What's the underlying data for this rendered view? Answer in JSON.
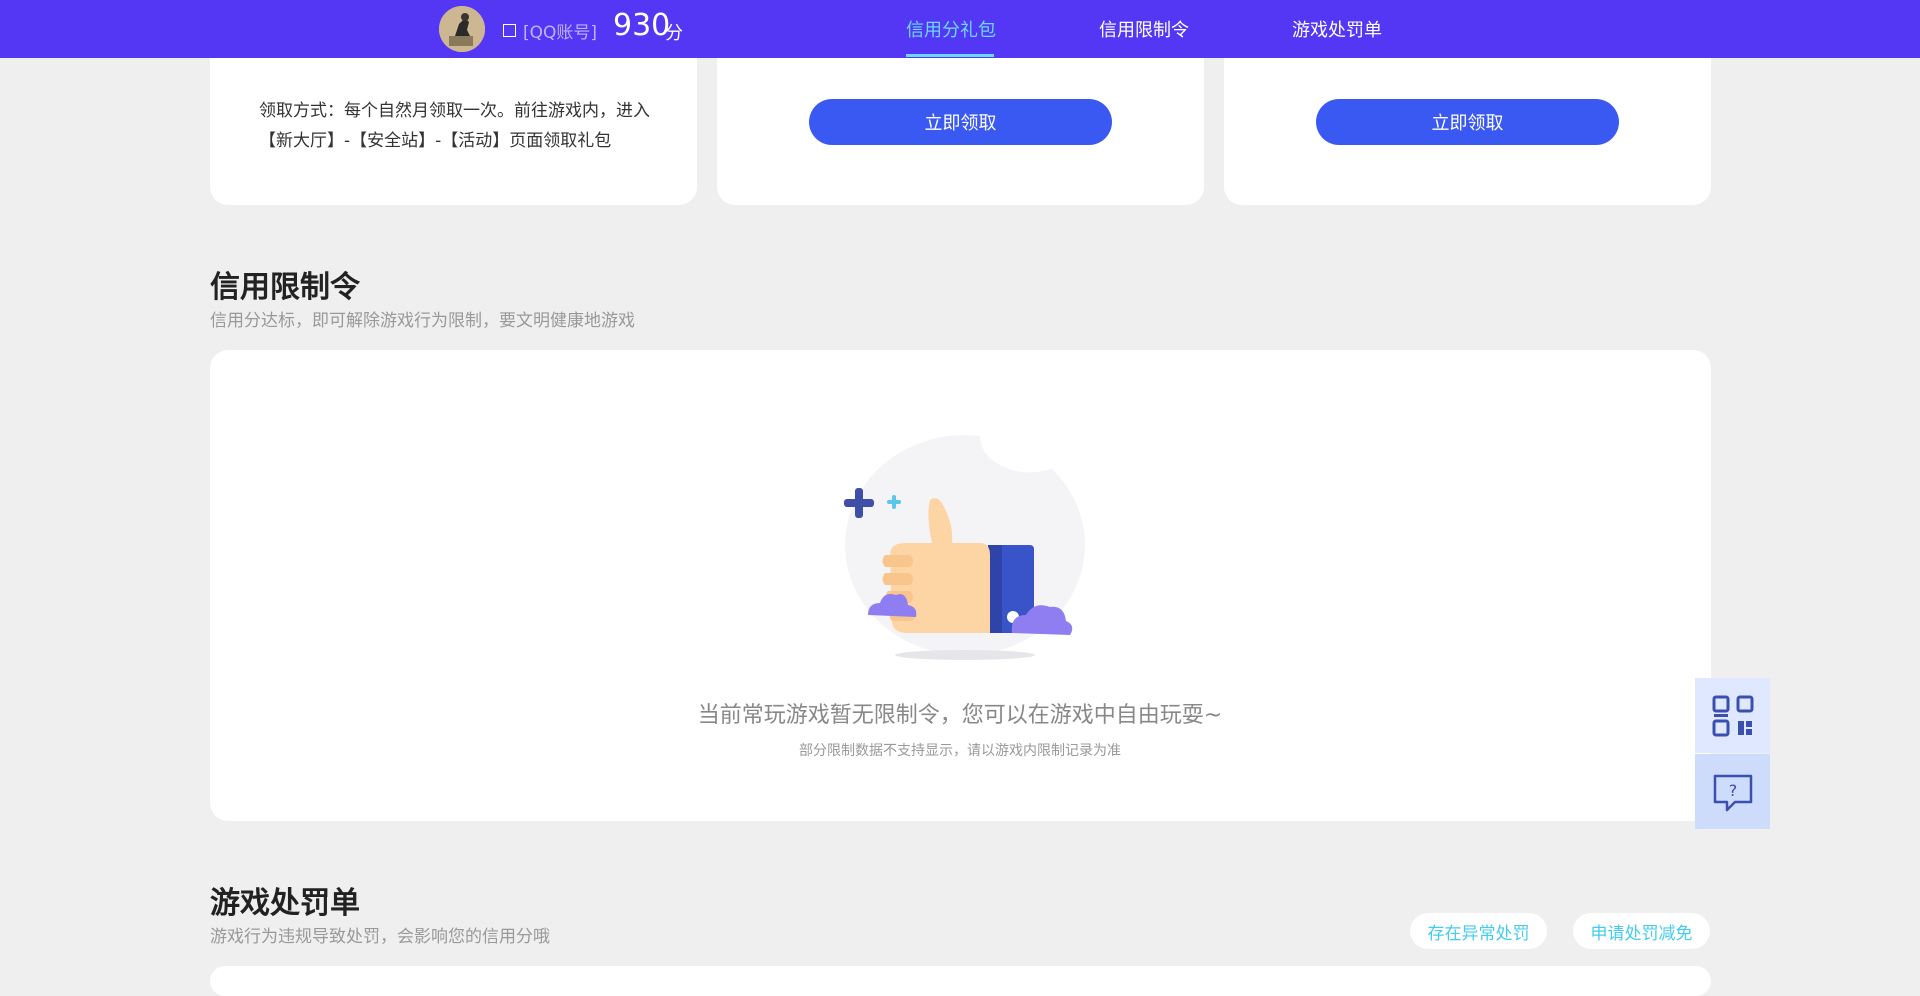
{
  "header": {
    "account_label": "[QQ账号]",
    "score": "930",
    "score_unit": "分",
    "tabs": [
      {
        "label": "信用分礼包",
        "active": true
      },
      {
        "label": "信用限制令",
        "active": false
      },
      {
        "label": "游戏处罚单",
        "active": false
      }
    ],
    "bg_color": "#5436f5",
    "active_color": "#6ad9ff"
  },
  "gift": {
    "method_text": "领取方式：每个自然月领取一次。前往游戏内，进入【新大厅】-【安全站】-【活动】页面领取礼包",
    "claim_label_1": "立即领取",
    "claim_label_2": "立即领取",
    "button_color": "#3a58f2"
  },
  "restriction": {
    "title": "信用限制令",
    "subtitle": "信用分达标，即可解除游戏行为限制，要文明健康地游戏",
    "empty_title": "当前常玩游戏暂无限制令，您可以在游戏中自由玩耍~",
    "empty_sub": "部分限制数据不支持显示，请以游戏内限制记录为准"
  },
  "penalty": {
    "title": "游戏处罚单",
    "subtitle": "游戏行为违规导致处罚，会影响您的信用分哦",
    "btn_abnormal": "存在异常处罚",
    "btn_reduce": "申请处罚减免"
  },
  "icons": {
    "side_top": "qr-code-icon",
    "side_bottom": "help-chat-icon"
  }
}
